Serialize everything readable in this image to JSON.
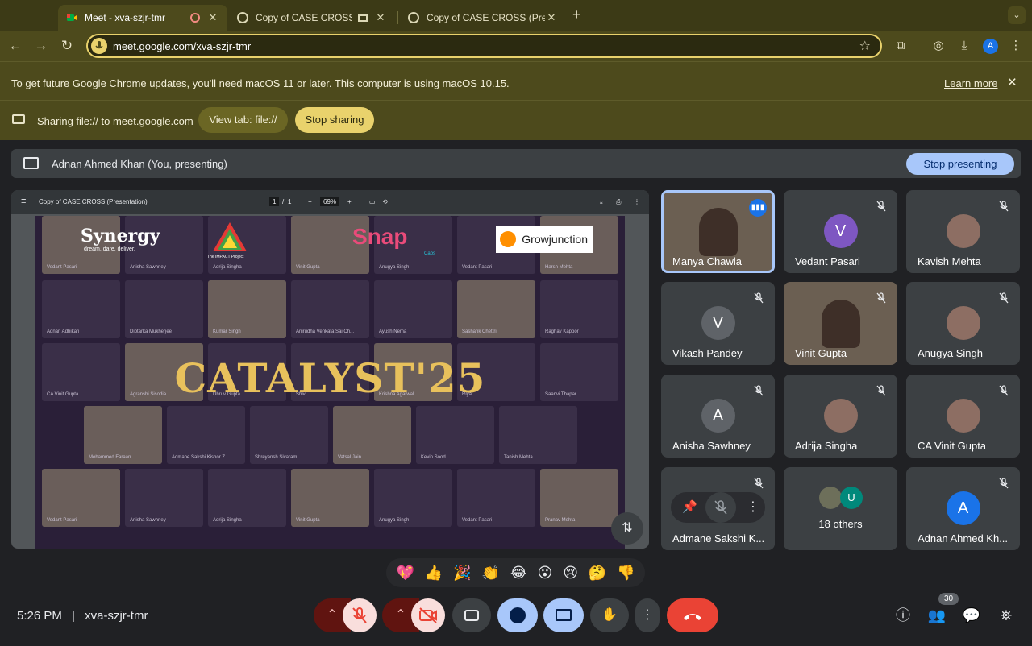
{
  "browser": {
    "tabs": [
      {
        "title": "Meet - xva-szjr-tmr",
        "active": true
      },
      {
        "title": "Copy of CASE CROSS (Pr",
        "active": false
      },
      {
        "title": "Copy of CASE CROSS (Prese",
        "active": false
      }
    ],
    "new_tab": "+",
    "url": "meet.google.com/xva-szjr-tmr",
    "profile_initial": "A",
    "update_message": "To get future Google Chrome updates, you'll need macOS 11 or later. This computer is using macOS 10.15.",
    "learn_more": "Learn more",
    "sharing_text": "Sharing file:// to meet.google.com",
    "view_tab_label": "View tab: file://",
    "stop_sharing_label": "Stop sharing",
    "accent": "#e9d26c"
  },
  "meet": {
    "presenter_text": "Adnan Ahmed Khan (You, presenting)",
    "stop_presenting_label": "Stop presenting",
    "pdf": {
      "title": "Copy of CASE CROSS (Presentation)",
      "page": "1",
      "page_total": "1",
      "zoom": "69%"
    },
    "slide": {
      "title": "CATALYST'25",
      "logos": {
        "synergy": "Synergy",
        "synergy_tag": "dream. dare. deliver.",
        "impact": "The IMPACT Project",
        "snap": "Snap",
        "snap_sub": "Cabs",
        "growjunction": "Growjunction"
      },
      "grid_names": [
        "Vedant Pasari",
        "Anisha Sawhney",
        "Adrija Singha",
        "Vinit Gupta",
        "Anugya Singh",
        "Vedant Pasari",
        "Harsh Mehta",
        "Adnan Adhikari",
        "Diptarka Mukherjee",
        "Kumar Singh",
        "Anirudha Venkata Sai Ch...",
        "Ayush Nema",
        "Sashank Chettri",
        "Raghav Kapoor",
        "CA Vinit Gupta",
        "Agranshi Sisodia",
        "Dhruv Gupta",
        "Shiv",
        "Krishna Agarwal",
        "Riya",
        "Saanvi Thapar",
        "Mohammed Faraan",
        "Admane Sakshi Kishor Z...",
        "Shreyansh Sivaram",
        "Vatsal Jain",
        "Kevin Sood",
        "Tanish Mehta",
        "Vedant Pasari",
        "Anisha Sawhney",
        "Adrija Singha",
        "Vinit Gupta",
        "Anugya Singh",
        "Vedant Pasari",
        "Pranav Mehta"
      ]
    },
    "tiles": [
      {
        "name": "Manya Chawla",
        "initial": "",
        "type": "camera",
        "speaking": true
      },
      {
        "name": "Vedant Pasari",
        "initial": "V",
        "type": "avatar",
        "color": "#7e57c2"
      },
      {
        "name": "Kavish Mehta",
        "initial": "",
        "type": "photo"
      },
      {
        "name": "Vikash Pandey",
        "initial": "V",
        "type": "avatar",
        "color": "#5f6368"
      },
      {
        "name": "Vinit Gupta",
        "initial": "",
        "type": "camera"
      },
      {
        "name": "Anugya Singh",
        "initial": "",
        "type": "photo"
      },
      {
        "name": "Anisha Sawhney",
        "initial": "A",
        "type": "avatar",
        "color": "#5f6368"
      },
      {
        "name": "Adrija Singha",
        "initial": "",
        "type": "photo"
      },
      {
        "name": "CA Vinit Gupta",
        "initial": "",
        "type": "photo"
      },
      {
        "name": "Admane Sakshi K...",
        "initial": "",
        "type": "hover"
      },
      {
        "name": "18 others",
        "initial": "U",
        "type": "others"
      },
      {
        "name": "Adnan Ahmed Kh...",
        "initial": "A",
        "type": "avatar",
        "color": "#1a73e8"
      }
    ],
    "reactions": [
      "💖",
      "👍",
      "🎉",
      "👏",
      "😂",
      "😮",
      "😢",
      "🤔",
      "👎"
    ],
    "time": "5:26 PM",
    "separator": "|",
    "meeting_code": "xva-szjr-tmr",
    "participant_count": "30",
    "colors": {
      "leave": "#ea4335",
      "mic_off_bg": "#f9dedc",
      "present": "#a8c7fa"
    }
  }
}
